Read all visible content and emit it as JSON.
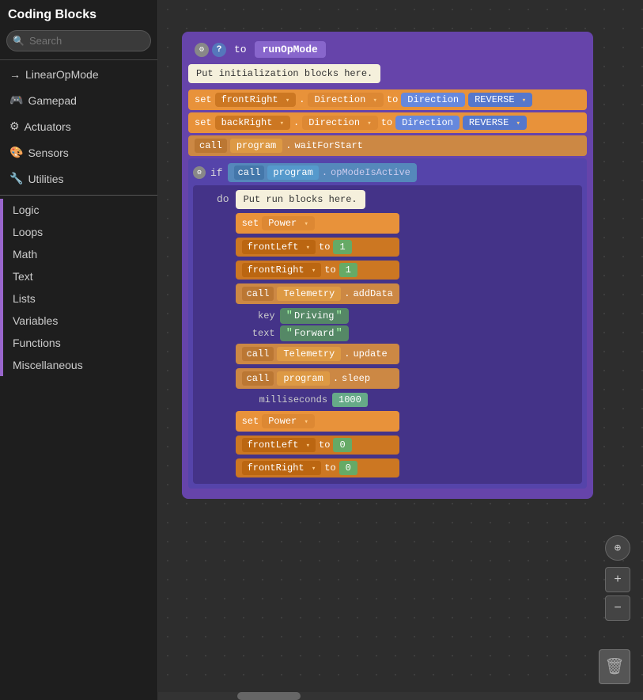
{
  "sidebar": {
    "title": "Coding Blocks",
    "search": {
      "placeholder": "Search"
    },
    "categories": [
      {
        "id": "linearopmode",
        "icon": "→",
        "label": "LinearOpMode"
      },
      {
        "id": "gamepad",
        "icon": "🎮",
        "label": "Gamepad"
      },
      {
        "id": "actuators",
        "icon": "⚙",
        "label": "Actuators"
      },
      {
        "id": "sensors",
        "icon": "🎨",
        "label": "Sensors"
      },
      {
        "id": "utilities",
        "icon": "🔧",
        "label": "Utilities"
      }
    ],
    "block_categories": [
      {
        "id": "logic",
        "label": "Logic"
      },
      {
        "id": "loops",
        "label": "Loops"
      },
      {
        "id": "math",
        "label": "Math"
      },
      {
        "id": "text",
        "label": "Text"
      },
      {
        "id": "lists",
        "label": "Lists"
      },
      {
        "id": "variables",
        "label": "Variables"
      },
      {
        "id": "functions",
        "label": "Functions"
      },
      {
        "id": "miscellaneous",
        "label": "Miscellaneous"
      }
    ]
  },
  "canvas": {
    "header": {
      "to_label": "to",
      "method": "runOpMode"
    },
    "init_block": "Put initialization blocks here.",
    "set_blocks": [
      {
        "keyword": "set",
        "var": "frontRight",
        "prop": "Direction",
        "to": "to",
        "dir_label": "Direction",
        "dir_value": "REVERSE"
      },
      {
        "keyword": "set",
        "var": "backRight",
        "prop": "Direction",
        "to": "to",
        "dir_label": "Direction",
        "dir_value": "REVERSE"
      }
    ],
    "call_block": {
      "call": "call",
      "obj": "program",
      "dot": ".",
      "method": "waitForStart"
    },
    "if_block": {
      "if_keyword": "if",
      "call": "call",
      "obj": "program",
      "dot": ".",
      "method": "opModeIsActive"
    },
    "do_block": {
      "do_keyword": "do",
      "run_label": "Put run blocks here.",
      "set_power": "set Power",
      "assignments": [
        {
          "var": "frontLeft",
          "to": "to",
          "val": "1"
        },
        {
          "var": "frontRight",
          "to": "to",
          "val": "1"
        }
      ],
      "call_adddata": {
        "call": "call",
        "obj": "Telemetry",
        "dot": ".",
        "method": "addData",
        "key_label": "key",
        "key_value": "Driving",
        "text_label": "text",
        "text_value": "Forward"
      },
      "call_update": {
        "call": "call",
        "obj": "Telemetry",
        "dot": ".",
        "method": "update"
      },
      "call_sleep": {
        "call": "call",
        "obj": "program",
        "dot": ".",
        "method": "sleep",
        "ms_label": "milliseconds",
        "ms_value": "1000"
      },
      "set_power2": "set Power",
      "zero_assignments": [
        {
          "var": "frontLeft",
          "to": "to",
          "val": "0"
        },
        {
          "var": "frontRight",
          "to": "to",
          "val": "0"
        }
      ]
    }
  },
  "controls": {
    "crosshair": "⊕",
    "plus": "+",
    "minus": "−",
    "trash": "🗑"
  }
}
